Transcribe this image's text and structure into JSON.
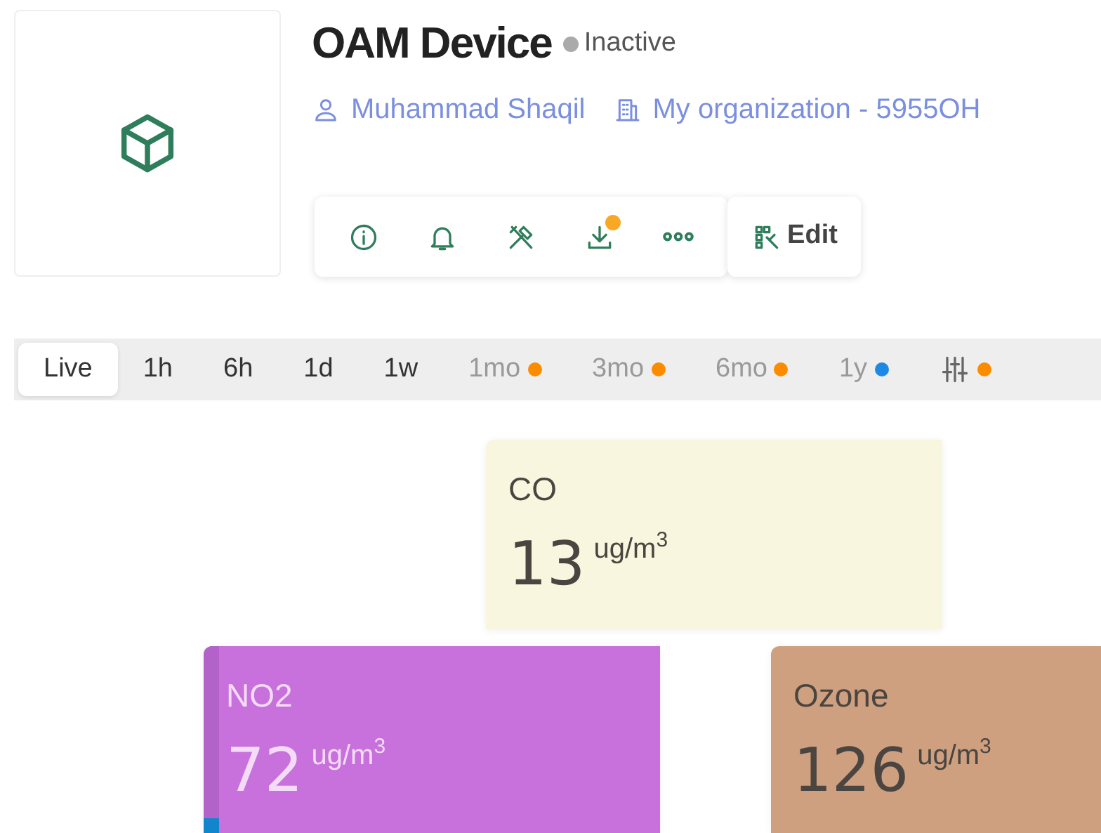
{
  "device": {
    "title": "OAM Device",
    "status": "Inactive",
    "owner": "Muhammad Shaqil",
    "organization": "My organization - 5955OH"
  },
  "toolbar": [
    {
      "kind": "info",
      "badge": false
    },
    {
      "kind": "bell",
      "badge": false
    },
    {
      "kind": "tools",
      "badge": false
    },
    {
      "kind": "download",
      "badge": true
    },
    {
      "kind": "more",
      "badge": false
    }
  ],
  "edit_button": "Edit",
  "ranges": [
    {
      "label": "Live",
      "selected": true,
      "disabled": false
    },
    {
      "label": "1h",
      "selected": false,
      "disabled": false
    },
    {
      "label": "6h",
      "selected": false,
      "disabled": false
    },
    {
      "label": "1d",
      "selected": false,
      "disabled": false
    },
    {
      "label": "1w",
      "selected": false,
      "disabled": false
    },
    {
      "label": "1mo",
      "selected": false,
      "disabled": true,
      "color": "#fb8c00"
    },
    {
      "label": "3mo",
      "selected": false,
      "disabled": true,
      "color": "#fb8c00"
    },
    {
      "label": "6mo",
      "selected": false,
      "disabled": true,
      "color": "#fb8c00"
    },
    {
      "label": "1y",
      "selected": false,
      "disabled": true,
      "color": "#1e88e5"
    },
    {
      "kind": "settings",
      "selected": false,
      "disabled": true,
      "color": "#fb8c00"
    }
  ],
  "cards": [
    {
      "name": "CO",
      "value": "13",
      "unit": "ug/m$^{3}$",
      "color": "#f8f6de"
    },
    {
      "name": "NO2",
      "value": "72",
      "unit": "ug/m$^{3}$",
      "color": "#c870dc"
    },
    {
      "name": "Ozone",
      "value": "126",
      "unit": "ug/m$^{3}$",
      "color": "#cfa07f"
    }
  ]
}
